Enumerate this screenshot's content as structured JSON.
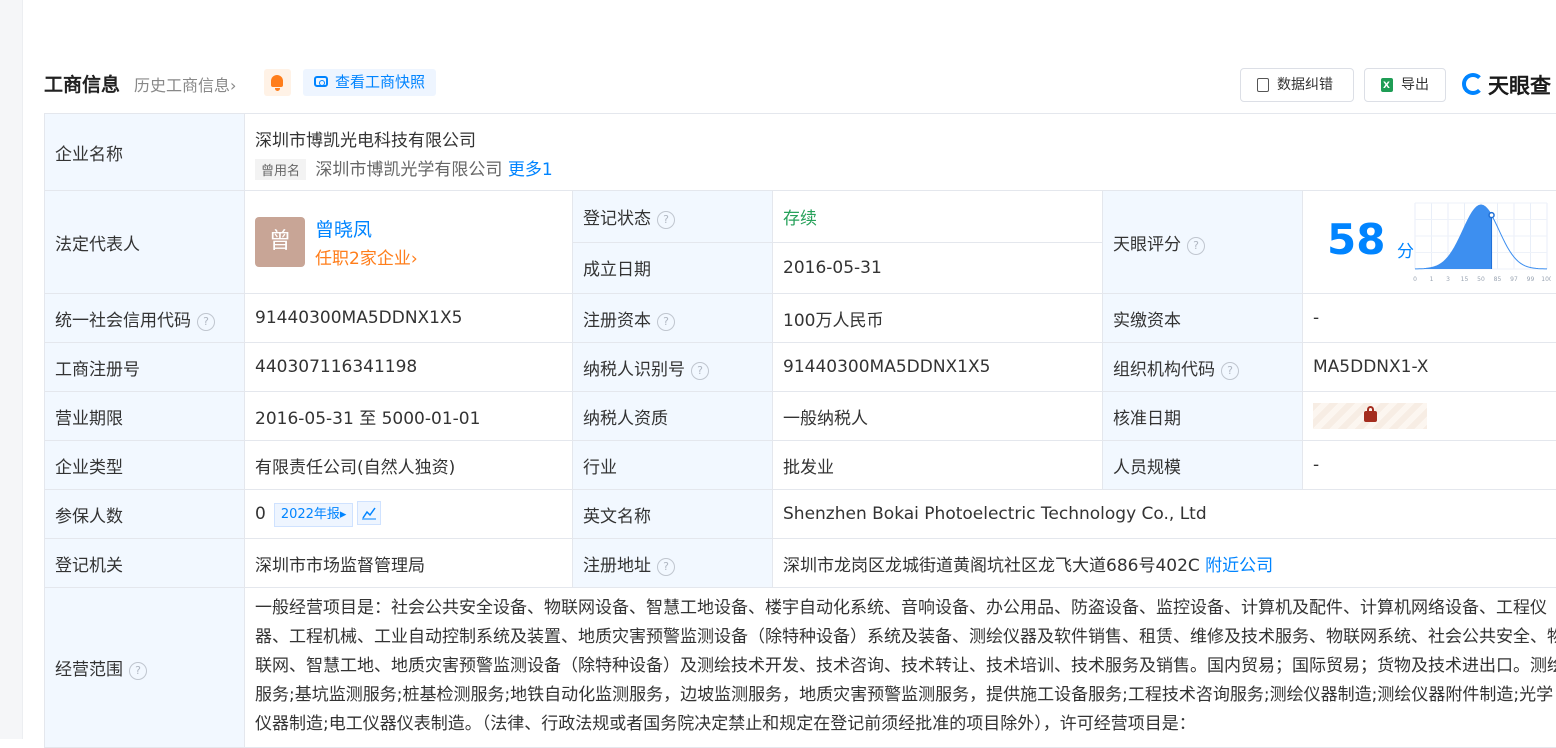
{
  "header": {
    "title": "工商信息",
    "history_label": "历史工商信息",
    "history_arrow": "›",
    "snapshot_label": "查看工商快照",
    "correct_label": "数据纠错",
    "export_label": "导出",
    "logo_text": "天眼查"
  },
  "company": {
    "name_label": "企业名称",
    "name": "深圳市博凯光电科技有限公司",
    "alias_tag": "曾用名",
    "alias": "深圳市博凯光学有限公司",
    "alias_more": "更多1"
  },
  "legal_rep": {
    "label": "法定代表人",
    "avatar_char": "曾",
    "name": "曾晓凤",
    "jobs": "任职2家企业›"
  },
  "reg_status": {
    "label": "登记状态",
    "value": "存续"
  },
  "found_date": {
    "label": "成立日期",
    "value": "2016-05-31"
  },
  "score": {
    "label": "天眼评分",
    "value": "58",
    "unit": "分",
    "level": 58,
    "axis_ticks": [
      "0",
      "1",
      "3",
      "15",
      "50",
      "85",
      "97",
      "99",
      "100"
    ]
  },
  "credit_code": {
    "label": "统一社会信用代码",
    "value": "91440300MA5DDNX1X5"
  },
  "reg_capital": {
    "label": "注册资本",
    "value": "100万人民币"
  },
  "paid_capital": {
    "label": "实缴资本",
    "value": "-"
  },
  "biz_reg_no": {
    "label": "工商注册号",
    "value": "440307116341198"
  },
  "taxpayer_id": {
    "label": "纳税人识别号",
    "value": "91440300MA5DDNX1X5"
  },
  "org_code": {
    "label": "组织机构代码",
    "value": "MA5DDNX1-X"
  },
  "biz_term": {
    "label": "营业期限",
    "value": "2016-05-31 至 5000-01-01"
  },
  "taxpayer_qual": {
    "label": "纳税人资质",
    "value": "一般纳税人"
  },
  "approval_date": {
    "label": "核准日期"
  },
  "company_type": {
    "label": "企业类型",
    "value": "有限责任公司(自然人独资)"
  },
  "industry": {
    "label": "行业",
    "value": "批发业"
  },
  "staff_size": {
    "label": "人员规模",
    "value": "-"
  },
  "insured": {
    "label": "参保人数",
    "value": "0",
    "year_tag": "2022年报▸"
  },
  "english_name": {
    "label": "英文名称",
    "value": "Shenzhen Bokai Photoelectric Technology Co., Ltd"
  },
  "reg_authority": {
    "label": "登记机关",
    "value": "深圳市市场监督管理局"
  },
  "reg_address": {
    "label": "注册地址",
    "value": "深圳市龙岗区龙城街道黄阁坑社区龙飞大道686号402C",
    "nearby": "附近公司"
  },
  "scope": {
    "label": "经营范围",
    "text": "一般经营项目是：社会公共安全设备、物联网设备、智慧工地设备、楼宇自动化系统、音响设备、办公用品、防盗设备、监控设备、计算机及配件、计算机网络设备、工程仪器、工程机械、工业自动控制系统及装置、地质灾害预警监测设备（除特种设备）系统及装备、测绘仪器及软件销售、租赁、维修及技术服务、物联网系统、社会公共安全、物联网、智慧工地、地质灾害预警监测设备（除特种设备）及测绘技术开发、技术咨询、技术转让、技术培训、技术服务及销售。国内贸易；国际贸易；货物及技术进出口。测绘服务;基坑监测服务;桩基检测服务;地铁自动化监测服务，边坡监测服务，地质灾害预警监测服务，提供施工设备服务;工程技术咨询服务;测绘仪器制造;测绘仪器附件制造;光学仪器制造;电工仪器仪表制造。（法律、行政法规或者国务院决定禁止和规定在登记前须经批准的项目除外），许可经营项目是："
  },
  "colors": {
    "accent": "#0084ff",
    "orange": "#ff7d1a",
    "green": "#27a15a",
    "key_bg": "#f2f8ff"
  }
}
